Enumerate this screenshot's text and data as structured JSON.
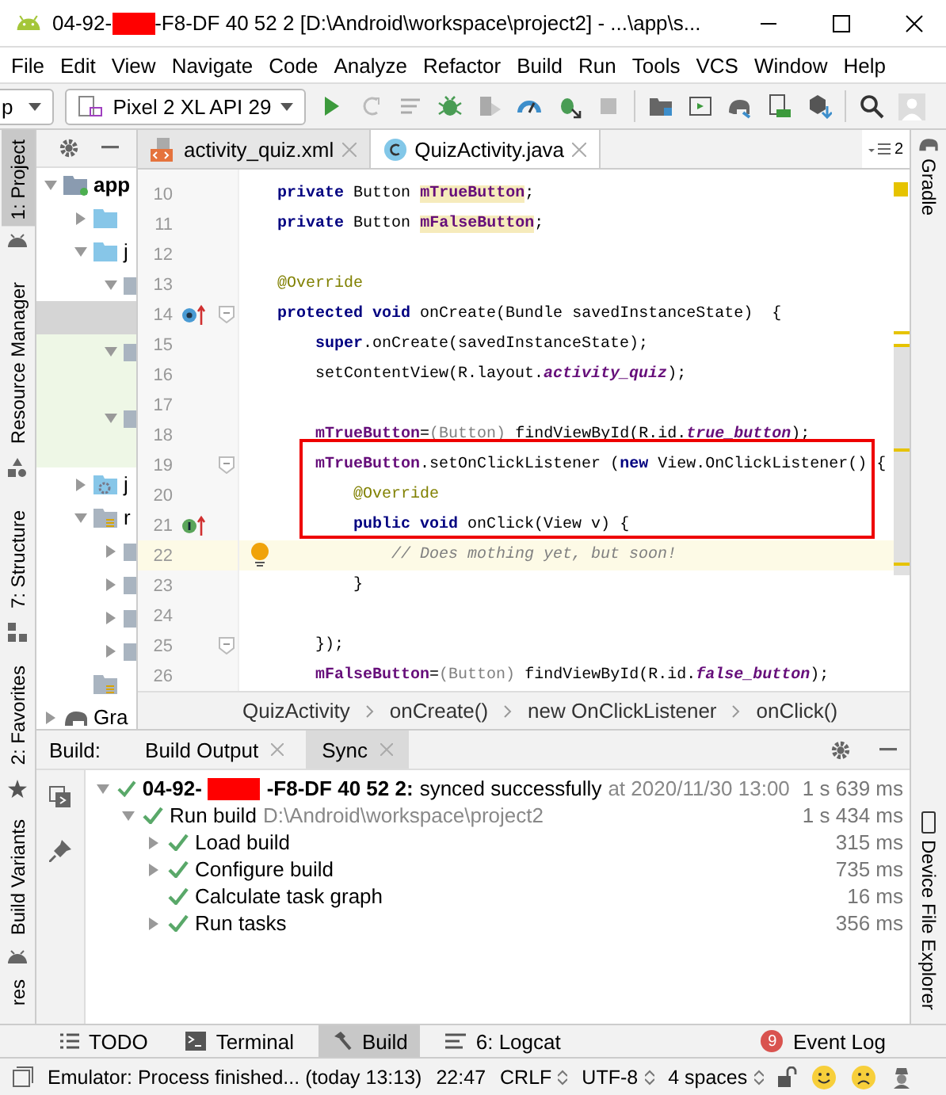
{
  "window": {
    "title_start": "04-92-",
    "title_end": "-F8-DF 40 52 2 [D:\\Android\\workspace\\project2] - ...\\app\\s..."
  },
  "menu": [
    "File",
    "Edit",
    "View",
    "Navigate",
    "Code",
    "Analyze",
    "Refactor",
    "Build",
    "Run",
    "Tools",
    "VCS",
    "Window",
    "Help"
  ],
  "toolbar": {
    "module_dropdown": "p",
    "device_dropdown": "Pixel 2 XL API 29"
  },
  "left_strip": [
    {
      "label": "1: Project",
      "selected": true
    },
    {
      "label": "Resource Manager",
      "selected": false
    },
    {
      "label": "7: Structure",
      "selected": false
    },
    {
      "label": "2: Favorites",
      "selected": false
    },
    {
      "label": "Build Variants",
      "selected": false
    },
    {
      "label": "res",
      "selected": false
    }
  ],
  "right_strip": [
    "Gradle",
    "Device File Explorer"
  ],
  "project": {
    "tree": [
      {
        "text": "app",
        "kind": "module",
        "expanded": true,
        "selected": false,
        "tinted": false,
        "children": [
          {
            "kind": "folder",
            "expanded": false,
            "selected": false,
            "tinted": false
          },
          {
            "text": "j",
            "kind": "folder",
            "expanded": true,
            "selected": false,
            "tinted": false,
            "children": [
              {
                "kind": "package",
                "expanded": true,
                "selected": false,
                "tinted": false,
                "children": [
                  {
                    "selected": true,
                    "tinted": false
                  }
                ]
              },
              {
                "kind": "package",
                "expanded": true,
                "selected": false,
                "tinted": true,
                "children": [
                  {
                    "selected": false,
                    "tinted": true
                  }
                ]
              },
              {
                "kind": "package",
                "expanded": true,
                "selected": false,
                "tinted": true,
                "children": [
                  {
                    "selected": false,
                    "tinted": true
                  }
                ]
              }
            ]
          },
          {
            "text": "j",
            "kind": "generated",
            "expanded": false,
            "selected": false,
            "tinted": false
          },
          {
            "text": "r",
            "kind": "resources",
            "expanded": true,
            "selected": false,
            "tinted": false,
            "children": [
              {
                "kind": "package",
                "expanded": false,
                "selected": false,
                "tinted": false
              },
              {
                "kind": "package",
                "expanded": false,
                "selected": false,
                "tinted": false
              },
              {
                "kind": "package",
                "expanded": false,
                "selected": false,
                "tinted": false
              },
              {
                "kind": "package",
                "expanded": false,
                "selected": false,
                "tinted": false
              }
            ]
          },
          {
            "kind": "resources",
            "selected": false,
            "tinted": false
          }
        ]
      },
      {
        "text": "Gra",
        "kind": "gradle",
        "expanded": false,
        "selected": false,
        "tinted": false
      }
    ]
  },
  "editor": {
    "tabs": [
      {
        "label": "activity_quiz.xml",
        "kind": "xml",
        "selected": false
      },
      {
        "label": "QuizActivity.java",
        "kind": "class",
        "selected": true
      }
    ],
    "tab_count": "2",
    "lines": [
      {
        "n": "10",
        "kind": "code",
        "current": false,
        "framed": false,
        "fold": false,
        "tokens": [
          {
            "kind": "kw",
            "t": "    private"
          },
          {
            "kind": "plain",
            "t": " Button "
          },
          {
            "kind": "field-hl",
            "t": "mTrueButton"
          },
          {
            "kind": "plain",
            "t": ";"
          }
        ]
      },
      {
        "n": "11",
        "kind": "code",
        "current": false,
        "framed": false,
        "fold": false,
        "tokens": [
          {
            "kind": "kw",
            "t": "    private"
          },
          {
            "kind": "plain",
            "t": " Button "
          },
          {
            "kind": "field-hl",
            "t": "mFalseButton"
          },
          {
            "kind": "plain",
            "t": ";"
          }
        ]
      },
      {
        "n": "12",
        "kind": "code",
        "current": false,
        "framed": false,
        "fold": false
      },
      {
        "n": "13",
        "kind": "code",
        "current": false,
        "framed": false,
        "fold": false,
        "tokens": [
          {
            "kind": "ann",
            "t": "    @Override"
          }
        ]
      },
      {
        "n": "14",
        "kind": "override",
        "current": false,
        "framed": false,
        "fold": true,
        "tokens": [
          {
            "kind": "kw",
            "t": "    protected void"
          },
          {
            "kind": "plain",
            "t": " onCreate(Bundle savedInstanceState)  {"
          }
        ]
      },
      {
        "n": "15",
        "kind": "code",
        "current": false,
        "framed": false,
        "fold": false,
        "tokens": [
          {
            "kind": "kw",
            "t": "        super"
          },
          {
            "kind": "plain",
            "t": ".onCreate(savedInstanceState);"
          }
        ]
      },
      {
        "n": "16",
        "kind": "code",
        "current": false,
        "framed": false,
        "fold": false,
        "tokens": [
          {
            "kind": "plain",
            "t": "        setContentView(R.layout."
          },
          {
            "kind": "ref",
            "t": "activity_quiz"
          },
          {
            "kind": "plain",
            "t": ");"
          }
        ]
      },
      {
        "n": "17",
        "kind": "code",
        "current": false,
        "framed": false,
        "fold": false
      },
      {
        "n": "18",
        "kind": "code",
        "current": false,
        "framed": false,
        "fold": false,
        "tokens": [
          {
            "kind": "field",
            "t": "        mTrueButton"
          },
          {
            "kind": "plain",
            "t": "="
          },
          {
            "kind": "dim",
            "t": "(Button)"
          },
          {
            "kind": "plain",
            "t": " findViewById(R.id."
          },
          {
            "kind": "ref",
            "t": "true_button"
          },
          {
            "kind": "plain",
            "t": ");"
          }
        ]
      },
      {
        "n": "19",
        "kind": "code",
        "current": false,
        "framed": true,
        "fold": true,
        "tokens": [
          {
            "kind": "field",
            "t": "        mTrueButton"
          },
          {
            "kind": "plain",
            "t": ".setOnClickListener ("
          },
          {
            "kind": "kw",
            "t": "new"
          },
          {
            "kind": "plain",
            "t": " View.OnClickListener() {"
          }
        ]
      },
      {
        "n": "20",
        "kind": "code",
        "current": false,
        "framed": true,
        "fold": false,
        "tokens": [
          {
            "kind": "ann",
            "t": "            @Override"
          }
        ]
      },
      {
        "n": "21",
        "kind": "implement",
        "current": false,
        "framed": true,
        "fold": false,
        "tokens": [
          {
            "kind": "kw",
            "t": "            public void"
          },
          {
            "kind": "plain",
            "t": " onClick(View v) {"
          }
        ]
      },
      {
        "n": "22",
        "kind": "bulb",
        "current": true,
        "framed": false,
        "fold": false,
        "tokens": [
          {
            "kind": "comment",
            "t": "                // Does mothing yet, but soon!"
          }
        ]
      },
      {
        "n": "23",
        "kind": "code",
        "current": false,
        "framed": false,
        "fold": false,
        "tokens": [
          {
            "kind": "plain",
            "t": "            }"
          }
        ]
      },
      {
        "n": "24",
        "kind": "code",
        "current": false,
        "framed": false,
        "fold": false
      },
      {
        "n": "25",
        "kind": "code",
        "current": false,
        "framed": false,
        "fold": true,
        "tokens": [
          {
            "kind": "plain",
            "t": "        });"
          }
        ]
      },
      {
        "n": "26",
        "kind": "code",
        "current": false,
        "framed": false,
        "fold": false,
        "tokens": [
          {
            "kind": "field",
            "t": "        mFalseButton"
          },
          {
            "kind": "plain",
            "t": "="
          },
          {
            "kind": "dim",
            "t": "(Button)"
          },
          {
            "kind": "plain",
            "t": " findViewById(R.id."
          },
          {
            "kind": "ref",
            "t": "false_button"
          },
          {
            "kind": "plain",
            "t": ");"
          }
        ]
      }
    ],
    "breadcrumbs": [
      "QuizActivity",
      "onCreate()",
      "new OnClickListener",
      "onClick()"
    ]
  },
  "build": {
    "label": "Build:",
    "tabs": [
      {
        "label": "Build Output",
        "selected": false
      },
      {
        "label": "Sync",
        "selected": true
      }
    ],
    "tree": [
      {
        "title_start": "04-92-",
        "title_end": "-F8-DF 40 52 2:",
        "message": "synced successfully",
        "detail": "at 2020/11/30 13:00",
        "time": "1 s 639 ms",
        "expanded": true,
        "children": [
          {
            "label": "Run build",
            "detail": "D:\\Android\\workspace\\project2",
            "time": "1 s 434 ms",
            "expanded": true,
            "children": [
              {
                "label": "Load build",
                "time": "315 ms",
                "expanded": false
              },
              {
                "label": "Configure build",
                "time": "735 ms",
                "expanded": false
              },
              {
                "label": "Calculate task graph",
                "time": "16 ms"
              },
              {
                "label": "Run tasks",
                "time": "356 ms",
                "expanded": false
              }
            ]
          }
        ]
      }
    ]
  },
  "tool_tabs": [
    {
      "label": "TODO",
      "kind": "list",
      "selected": false
    },
    {
      "label": "Terminal",
      "kind": "terminal",
      "selected": false
    },
    {
      "label": "Build",
      "kind": "hammer",
      "selected": true
    },
    {
      "label": "6: Logcat",
      "kind": "log",
      "selected": false
    }
  ],
  "event_log": {
    "label": "Event Log",
    "count": "9"
  },
  "status_bar": {
    "message": "Emulator: Process finished... (today 13:13)",
    "position": "22:47",
    "line_separator": "CRLF",
    "encoding": "UTF-8",
    "indent": "4 spaces"
  }
}
